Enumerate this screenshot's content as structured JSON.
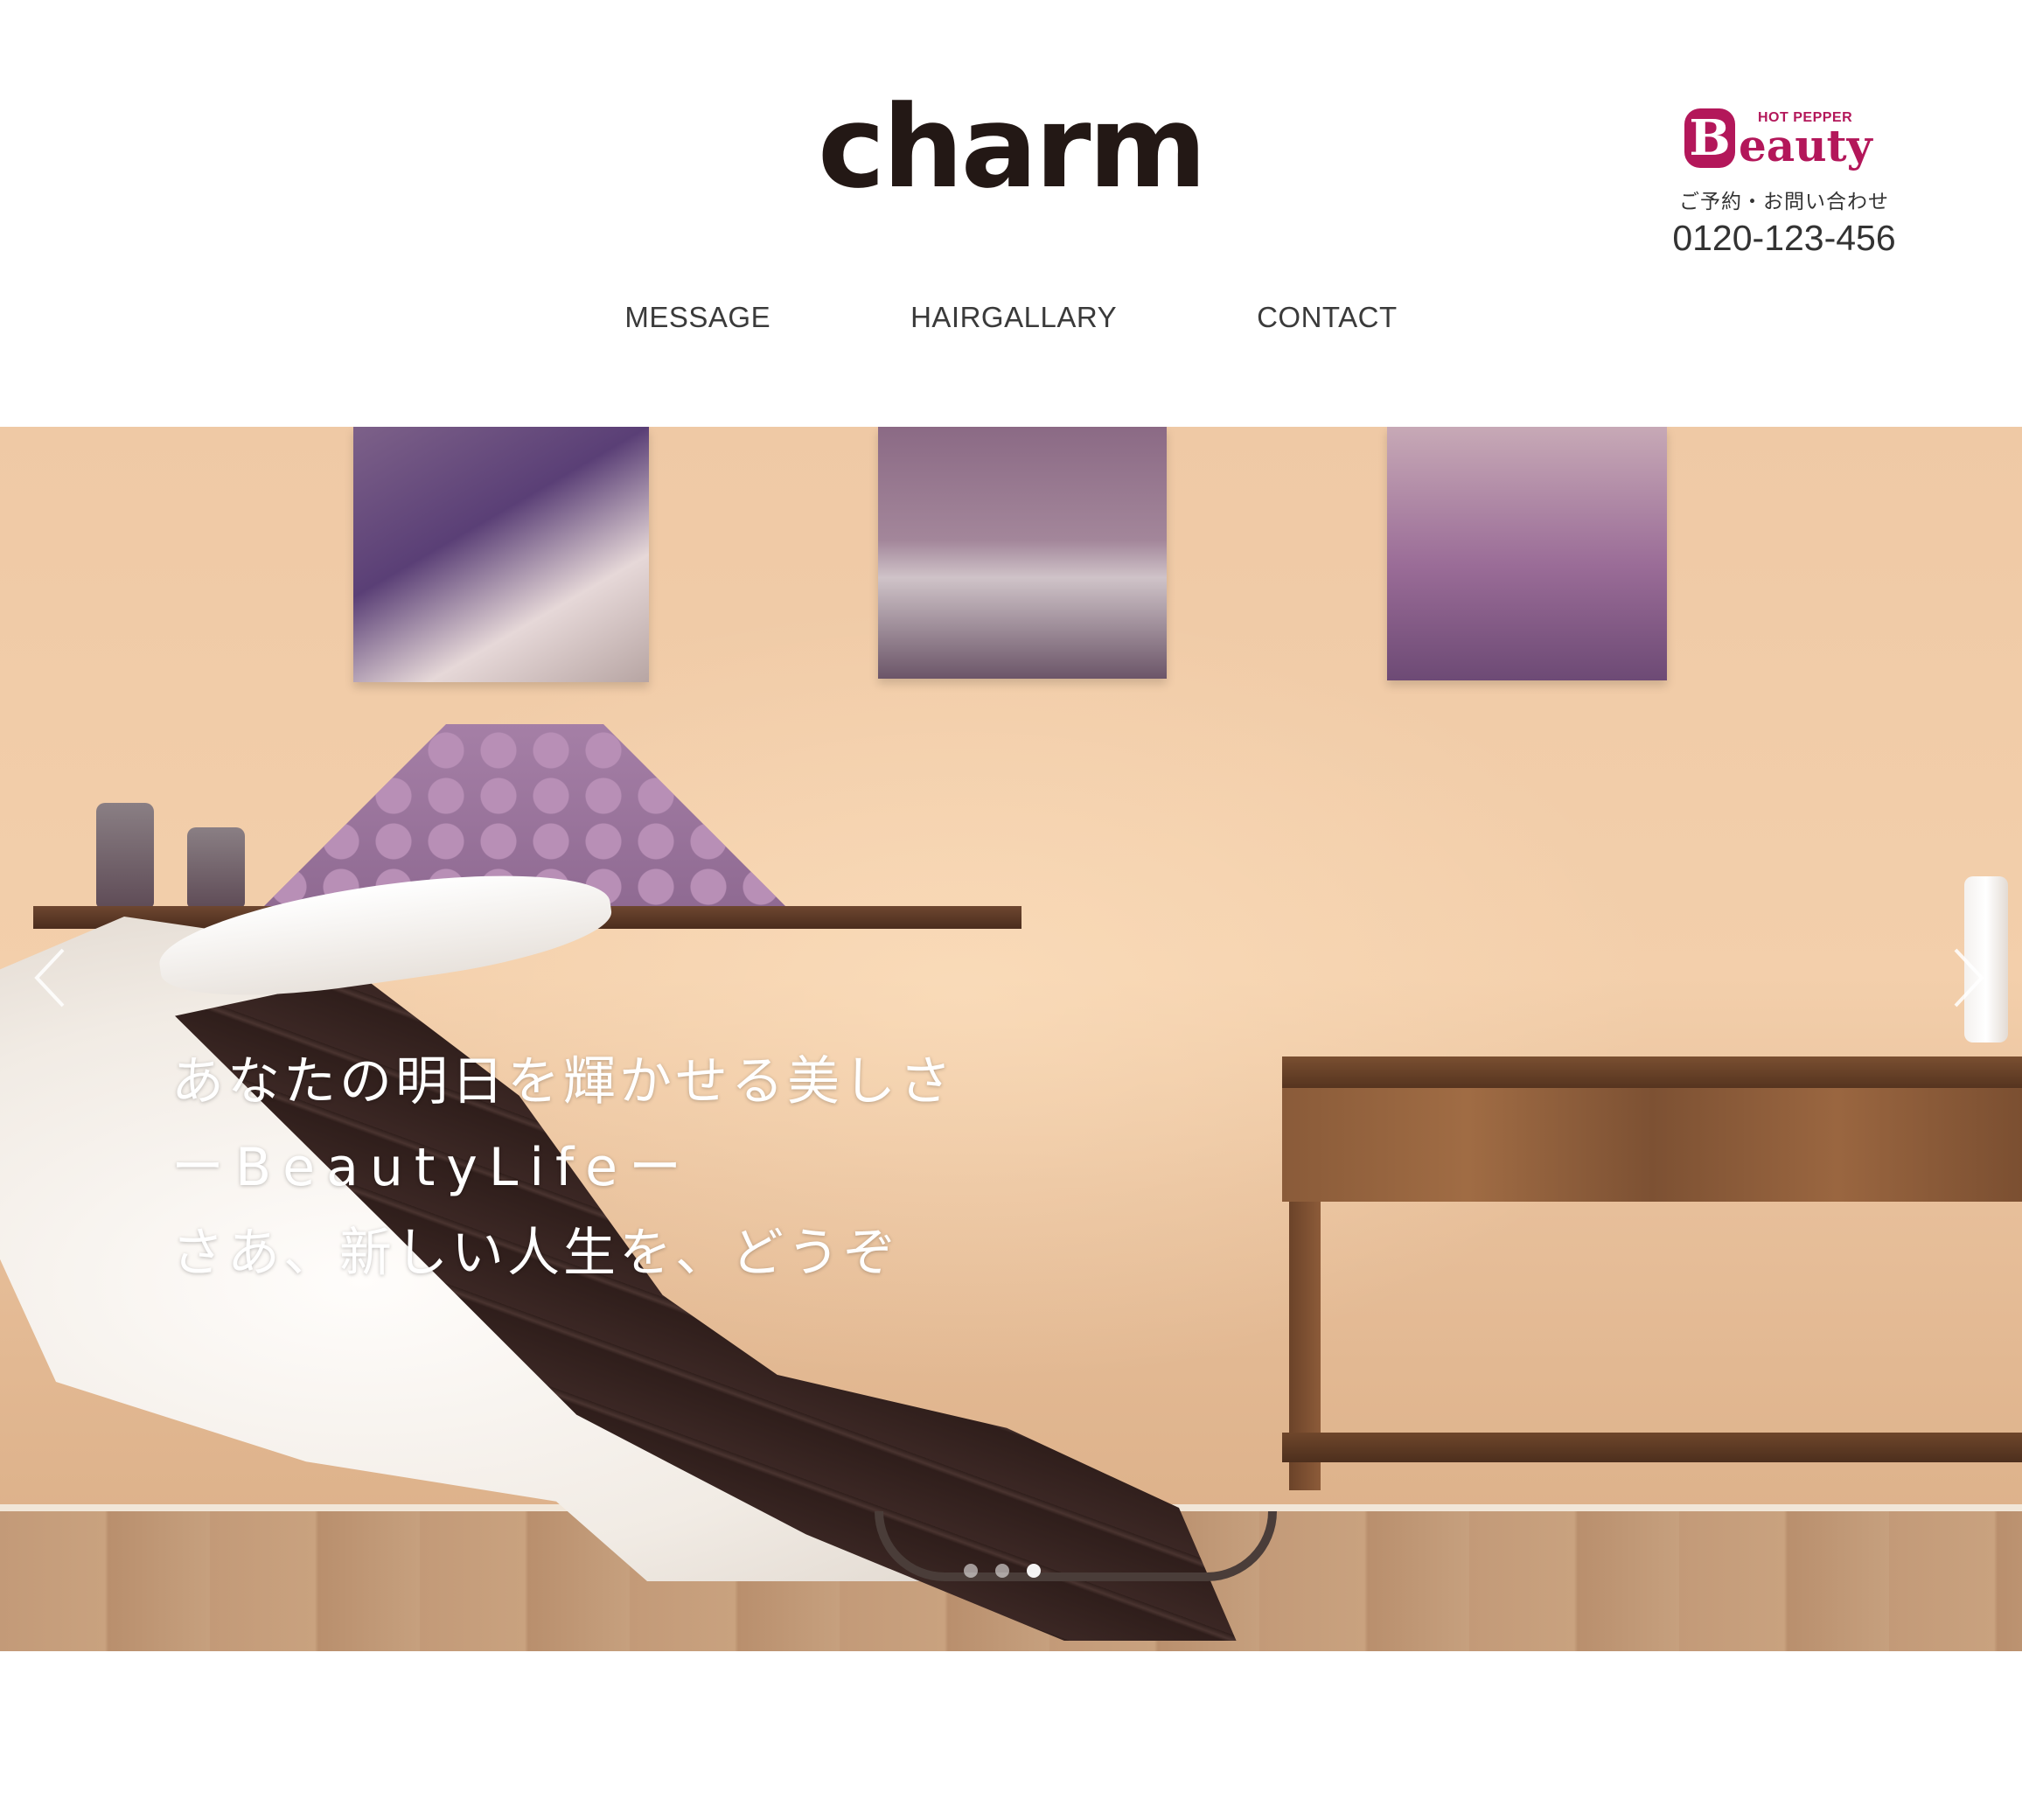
{
  "header": {
    "logo_text": "charm",
    "booking": {
      "badge_top": "HOT PEPPER",
      "badge_initial": "B",
      "badge_word": "eauty",
      "label": "ご予約・お問い合わせ",
      "phone": "0120-123-456"
    },
    "nav": [
      {
        "label": "MESSAGE"
      },
      {
        "label": "HAIRGALLARY"
      },
      {
        "label": "CONTACT"
      }
    ]
  },
  "hero": {
    "caption_lines": [
      "あなたの明日を輝かせる美しさ",
      "ーBeautyLifeー",
      "さあ、新しい人生を、どうぞ"
    ],
    "slides_total": 3,
    "active_slide": 2
  },
  "colors": {
    "brand": "#231815",
    "hotpepper": "#b3175a",
    "nav_text": "#3a3a3a"
  },
  "icons": {
    "prev": "chevron-left-icon",
    "next": "chevron-right-icon"
  }
}
